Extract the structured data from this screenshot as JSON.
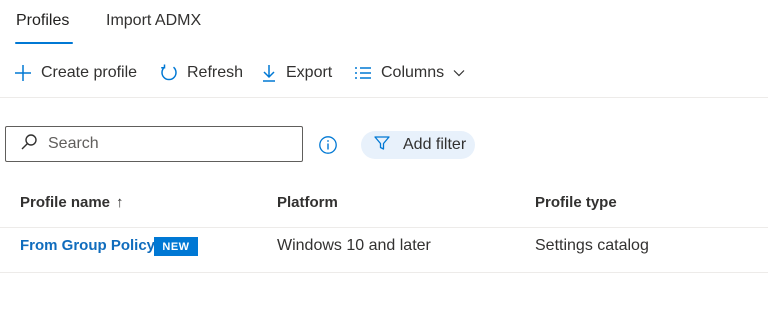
{
  "tabs": [
    {
      "label": "Profiles",
      "active": true
    },
    {
      "label": "Import ADMX",
      "active": false
    }
  ],
  "toolbar": {
    "create_label": "Create profile",
    "refresh_label": "Refresh",
    "export_label": "Export",
    "columns_label": "Columns"
  },
  "search": {
    "placeholder": "Search",
    "value": ""
  },
  "filter": {
    "label": "Add filter"
  },
  "table": {
    "headers": [
      "Profile name",
      "Platform",
      "Profile type"
    ],
    "sort_indicator": "↑",
    "rows": [
      {
        "name": "From Group Policy",
        "badge": "NEW",
        "platform": "Windows 10 and later",
        "profile_type": "Settings catalog"
      }
    ]
  },
  "colors": {
    "accent": "#0078d4",
    "link": "#0f6cbd",
    "pill_bg": "#e8f1fb"
  }
}
